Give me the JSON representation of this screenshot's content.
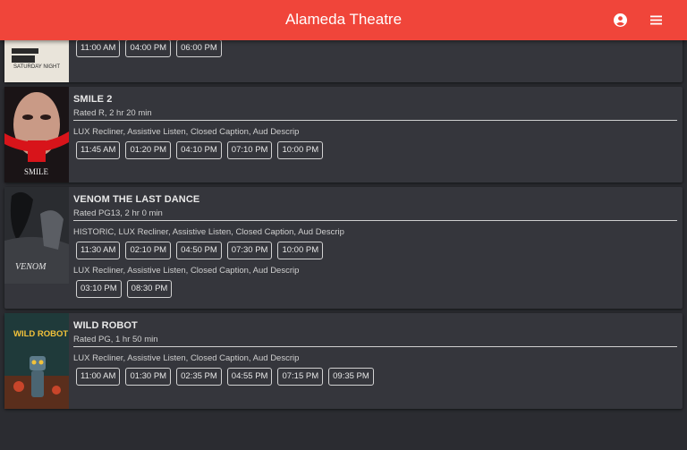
{
  "header": {
    "title": "Alameda Theatre",
    "account_icon": "account-circle-icon",
    "menu_icon": "hamburger-menu-icon"
  },
  "colors": {
    "header_bg": "#f0453a",
    "page_bg": "#2b2c31",
    "card_bg": "#35363c"
  },
  "movies": [
    {
      "poster_text": "SMILE",
      "title": "SMILE 2",
      "rating": "Rated R, 2 hr 20 min",
      "format_groups": [
        {
          "formats": "LUX Recliner, Assistive Listen, Closed Caption, Aud Descrip",
          "times": [
            "11:45 AM",
            "01:20 PM",
            "04:10 PM",
            "07:10 PM",
            "10:00 PM"
          ]
        }
      ]
    },
    {
      "poster_text": "VENOM",
      "title": "VENOM THE LAST DANCE",
      "rating": "Rated PG13, 2 hr 0 min",
      "format_groups": [
        {
          "formats": "HISTORIC, LUX Recliner, Assistive Listen, Closed Caption, Aud Descrip",
          "times": [
            "11:30 AM",
            "02:10 PM",
            "04:50 PM",
            "07:30 PM",
            "10:00 PM"
          ]
        },
        {
          "formats": "LUX Recliner, Assistive Listen, Closed Caption, Aud Descrip",
          "times": [
            "03:10 PM",
            "08:30 PM"
          ]
        }
      ]
    },
    {
      "poster_text": "WILD ROBOT",
      "title": "WILD ROBOT",
      "rating": "Rated PG, 1 hr 50 min",
      "format_groups": [
        {
          "formats": "LUX Recliner, Assistive Listen, Closed Caption, Aud Descrip",
          "times": [
            "11:00 AM",
            "01:30 PM",
            "02:35 PM",
            "04:55 PM",
            "07:15 PM",
            "09:35 PM"
          ]
        }
      ]
    }
  ],
  "partial_movie": {
    "poster_text": "SATURDAY NIGHT",
    "times": [
      "11:00 AM",
      "04:00 PM",
      "06:00 PM"
    ]
  }
}
